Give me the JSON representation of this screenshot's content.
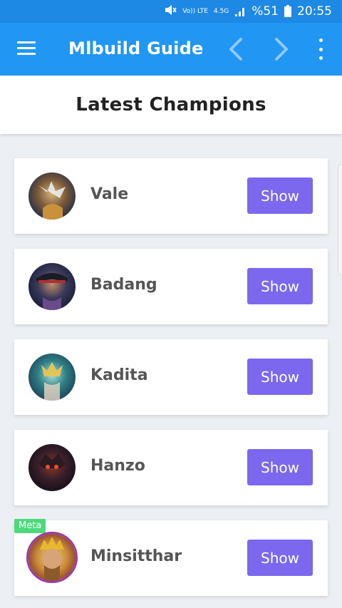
{
  "status_bar": {
    "volte": "Vo)) LTE",
    "network": "4.5G",
    "battery": "%51",
    "time": "20:55"
  },
  "app_bar": {
    "title": "Mlbuild Guide",
    "icons": [
      "menu-icon",
      "chevron-left-icon",
      "chevron-right-icon",
      "more-vert-icon"
    ]
  },
  "header": {
    "title": "Latest Champions"
  },
  "champions": [
    {
      "name": "Vale",
      "button": "Show"
    },
    {
      "name": "Badang",
      "button": "Show"
    },
    {
      "name": "Kadita",
      "button": "Show"
    },
    {
      "name": "Hanzo",
      "button": "Show"
    },
    {
      "name": "Minsitthar",
      "button": "Show",
      "badge": "Meta"
    }
  ],
  "colors": {
    "status_bar": "#1e88e5",
    "app_bar": "#2196f3",
    "button": "#7b68ee",
    "badge": "#4cd97b",
    "background": "#eceff3"
  }
}
